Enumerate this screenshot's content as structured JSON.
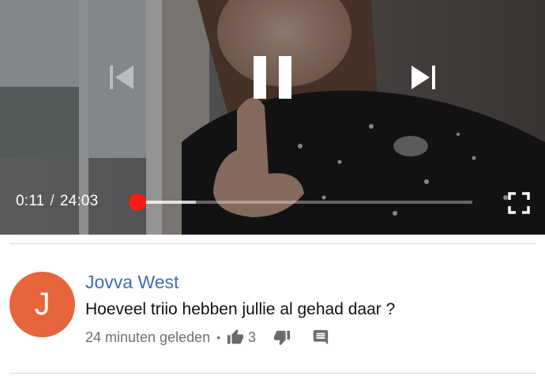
{
  "player": {
    "current_time": "0:11",
    "separator": "/",
    "duration": "24:03",
    "played_fraction": 0.0076,
    "buffered_fraction": 0.175,
    "controls": {
      "previous": "skip-previous-icon",
      "pause": "pause-icon",
      "next": "skip-next-icon",
      "fullscreen": "fullscreen-icon"
    },
    "accent_color": "#ff0000"
  },
  "comment": {
    "avatar_letter": "J",
    "avatar_color": "#e8643b",
    "author": "Jovva West",
    "text": "Hoeveel triio hebben jullie al gehad daar ?",
    "timestamp": "24 minuten geleden",
    "bullet": "•",
    "like_count": "3",
    "actions": {
      "like": "thumb-up-icon",
      "dislike": "thumb-down-icon",
      "reply": "reply-icon"
    }
  }
}
